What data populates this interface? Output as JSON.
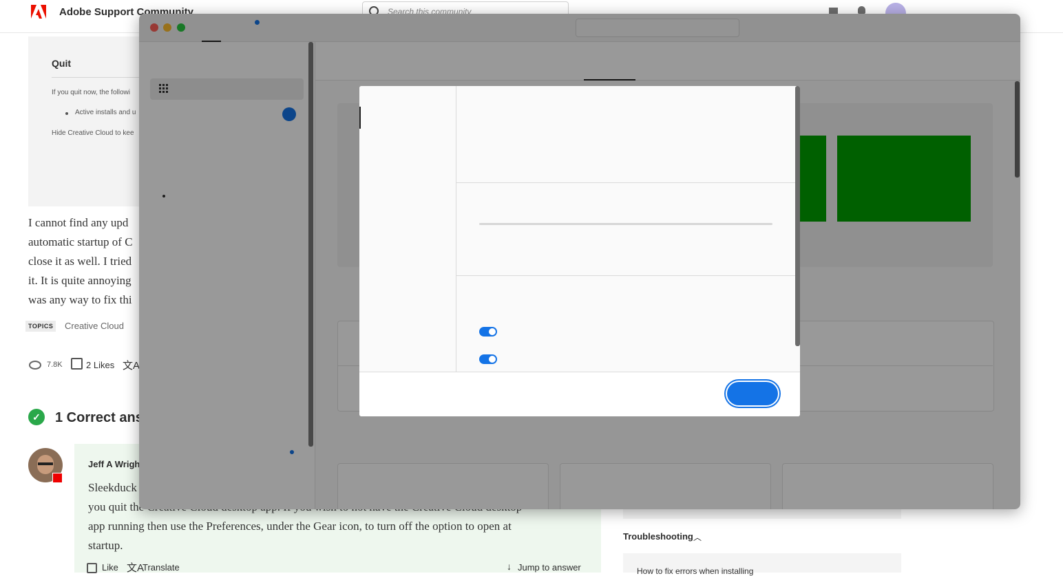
{
  "site": {
    "title": "Adobe Support Community",
    "search_placeholder": "Search this community",
    "icons": [
      "adobe-logo",
      "mail-icon",
      "bell-icon",
      "avatar"
    ],
    "brand_color": "#eb1000"
  },
  "quit_dialog_preview": {
    "title": "Quit",
    "line1": "If you quit now, the followi",
    "bullet": "Active installs and u",
    "line3": "Hide Creative Cloud to kee"
  },
  "post": {
    "body_lines": [
      "I cannot find any upd",
      "automatic startup of C",
      "close it as well. I tried",
      "it. It is quite annoying",
      "was any way to fix thi"
    ],
    "topics_tag": "TOPICS",
    "topic": "Creative Cloud",
    "views": "7.8K",
    "likes": "2 Likes",
    "translate_glyph": "文A T"
  },
  "answers": {
    "heading": "1 Correct answ",
    "author": "Jeff A Wright",
    "text_lines": [
      "Sleekduck",
      "you quit the Creative Cloud desktop app. If you wish to not have the Creative Cloud desktop",
      "app running then use the Preferences, under the Gear icon, to turn off the option to open at",
      "startup."
    ],
    "like_label": "Like",
    "translate_label": "Translate",
    "jump_label": "Jump to answer"
  },
  "sidebar_right": {
    "troubleshooting": "Troubleshooting",
    "link": "How to fix errors when installing"
  },
  "app_window": {
    "accent_color": "#1473e6",
    "preferences": {
      "toggles": [
        {
          "on": true
        },
        {
          "on": true
        }
      ],
      "progress": 0
    }
  }
}
